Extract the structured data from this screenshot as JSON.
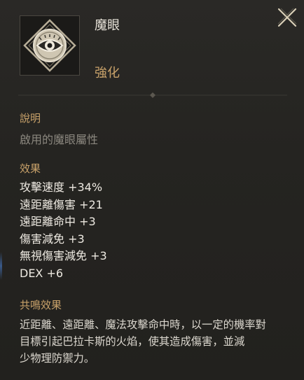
{
  "item": {
    "name": "魔眼",
    "tag": "強化",
    "icon": "eye-icon"
  },
  "close_icon": "close-icon",
  "description": {
    "heading": "說明",
    "text": "啟用的魔眼屬性"
  },
  "effects": {
    "heading": "效果",
    "lines": [
      "攻擊速度 +34%",
      "遠距離傷害 +21",
      "遠距離命中 +3",
      "傷害減免 +3",
      "無視傷害減免 +3",
      "DEX +6"
    ]
  },
  "resonance": {
    "heading": "共鳴效果",
    "lines": [
      "近距離、遠距離、魔法攻擊命中時，以一定的機率對",
      "目標引起巴拉卡斯的火焰，使其造成傷害，並減",
      "少物理防禦力。"
    ]
  },
  "colors": {
    "accent": "#c9a26a",
    "text": "#eeeae2",
    "muted": "#8b877f",
    "background": "#252421"
  }
}
